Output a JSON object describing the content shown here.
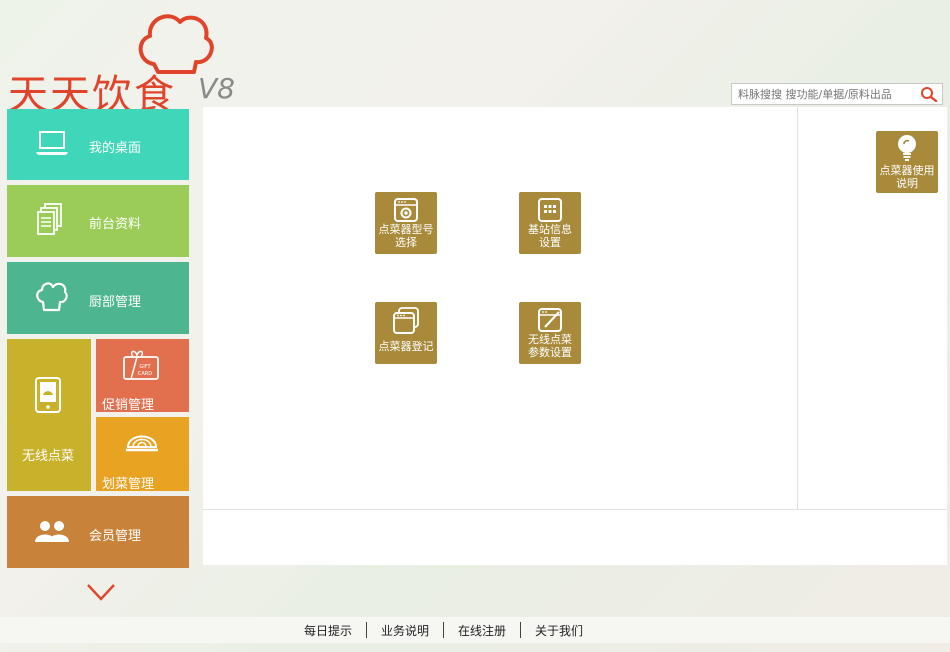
{
  "logo": {
    "brand": "天天饮食",
    "version": "V8"
  },
  "search": {
    "placeholder": "料脉搜搜 搜功能/单据/原料出品"
  },
  "nav": {
    "desktop": "我的桌面",
    "front": "前台资料",
    "kitchen": "厨部管理",
    "wireless": "无线点菜",
    "promo": "促销管理",
    "dish": "划菜管理",
    "member": "会员管理",
    "gift_line1": "GIFT",
    "gift_line2": "CARD"
  },
  "functions": {
    "model": {
      "l1": "点菜器型号",
      "l2": "选择"
    },
    "station": {
      "l1": "基站信息",
      "l2": "设置"
    },
    "register": {
      "l1": "点菜器登记"
    },
    "params": {
      "l1": "无线点菜",
      "l2": "参数设置"
    }
  },
  "help": {
    "l1": "点菜器使用",
    "l2": "说明"
  },
  "footer": [
    "每日提示",
    "业务说明",
    "在线注册",
    "关于我们"
  ]
}
